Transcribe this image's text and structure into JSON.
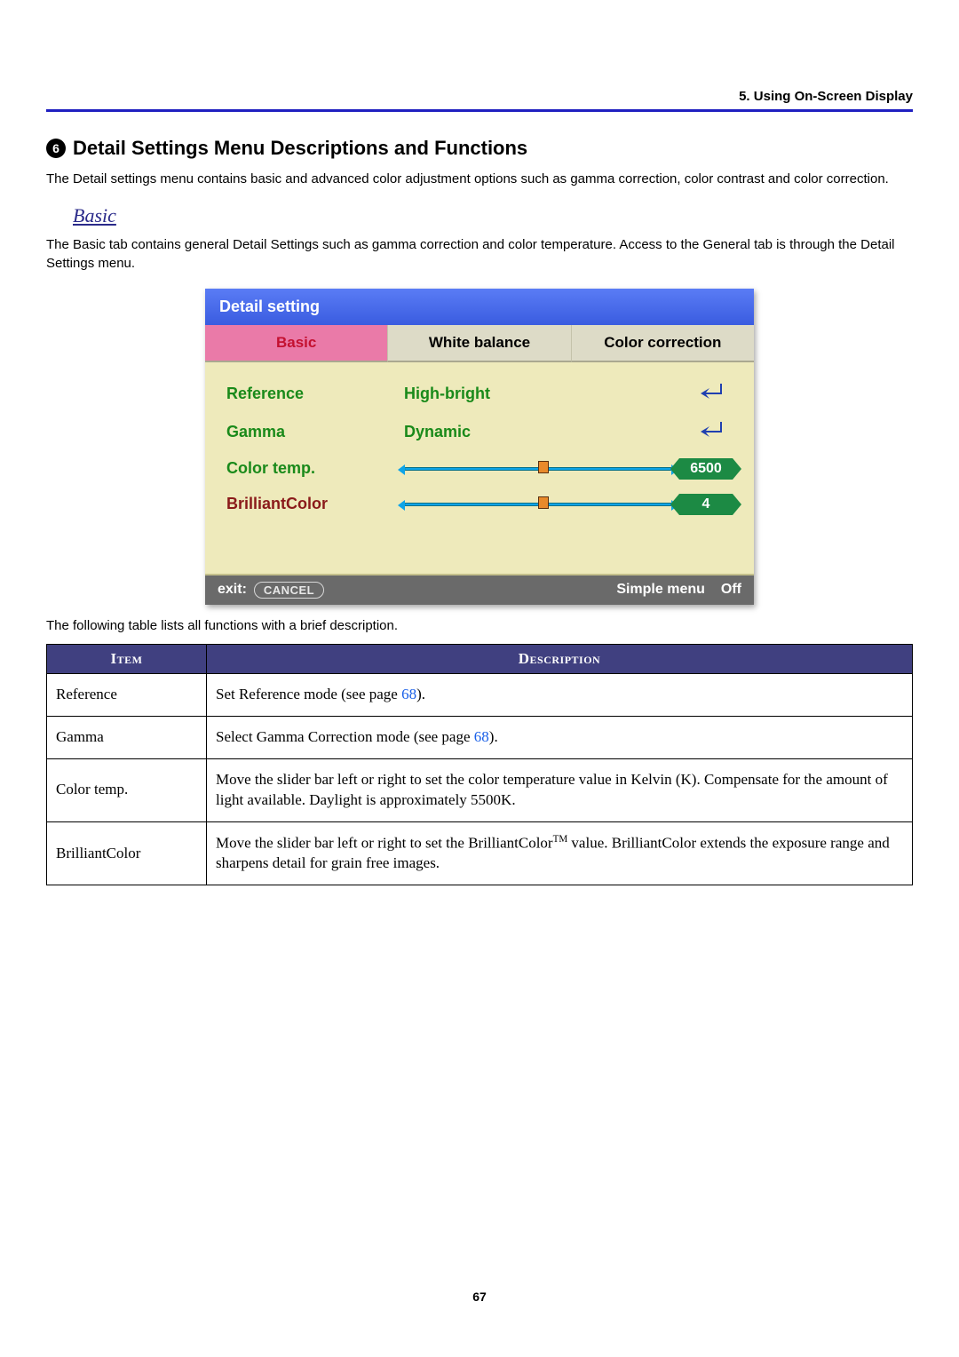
{
  "header": {
    "section": "5. Using On-Screen Display"
  },
  "title": {
    "num": "6",
    "text": "Detail Settings Menu Descriptions and Functions"
  },
  "intro": "The Detail settings menu contains basic and advanced color adjustment options such as gamma correction, color contrast and color correction.",
  "sub": {
    "heading": "Basic",
    "text": "The Basic tab contains general Detail Settings such as gamma correction and color temperature. Access to the General tab is through the Detail Settings menu."
  },
  "osd": {
    "title": "Detail setting",
    "tabs": [
      "Basic",
      "White balance",
      "Color correction"
    ],
    "rows": {
      "reference": {
        "label": "Reference",
        "value": "High-bright"
      },
      "gamma": {
        "label": "Gamma",
        "value": "Dynamic"
      },
      "colortemp": {
        "label": "Color temp.",
        "badge": "6500",
        "thumbPct": 50
      },
      "brilliant": {
        "label": "BrilliantColor",
        "badge": "4",
        "thumbPct": 50
      }
    },
    "footer": {
      "exit": "exit:",
      "cancel": "CANCEL",
      "simple": "Simple menu",
      "off": "Off"
    }
  },
  "table_intro": "The following table lists all functions with a brief description.",
  "table": {
    "headers": {
      "item": "Item",
      "desc": "Description"
    },
    "rows": [
      {
        "item": "Reference",
        "desc_a": "Set Reference mode (see page ",
        "link": "68",
        "desc_b": ")."
      },
      {
        "item": "Gamma",
        "desc_a": "Select Gamma Correction mode (see page ",
        "link": "68",
        "desc_b": ")."
      },
      {
        "item": "Color temp.",
        "desc_a": "Move the slider bar left or right to set the color temperature value in Kelvin (K). Compensate for the amount of light available. Daylight is approximately 5500K.",
        "link": "",
        "desc_b": ""
      },
      {
        "item": "BrilliantColor",
        "desc_a": "Move the slider bar left or right to set the BrilliantColor",
        "sup": "TM",
        "desc_b": " value. BrilliantColor extends the exposure range and sharpens detail for grain free images."
      }
    ]
  },
  "page_num": "67"
}
